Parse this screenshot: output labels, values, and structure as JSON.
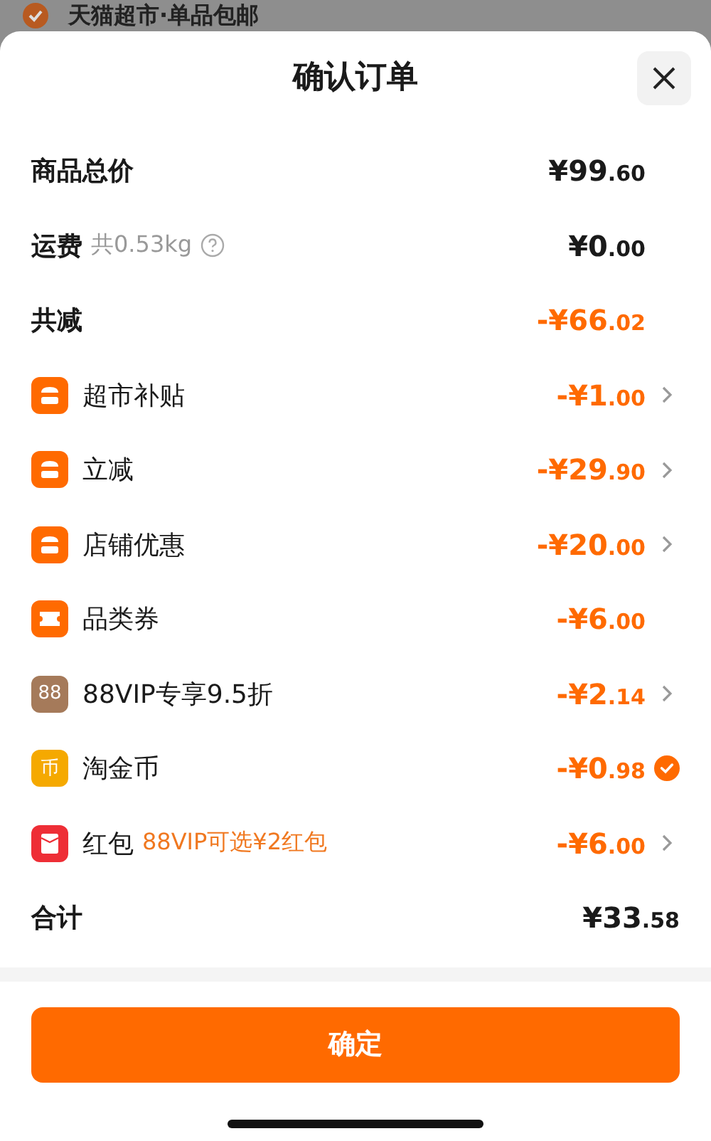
{
  "background": {
    "checked": true,
    "text": "天猫超市·单品包邮"
  },
  "sheet": {
    "title": "确认订单"
  },
  "summary": [
    {
      "label": "商品总价",
      "whole": "¥99",
      "cents": ".60",
      "highlight": false
    },
    {
      "label": "运费",
      "note": "共0.53kg",
      "help": true,
      "whole": "¥0",
      "cents": ".00",
      "highlight": false
    },
    {
      "label": "共减",
      "whole": "-¥66",
      "cents": ".02",
      "highlight": true
    }
  ],
  "discounts": [
    {
      "kind": "store",
      "label": "超市补贴",
      "whole": "-¥1",
      "cents": ".00",
      "expandable": true
    },
    {
      "kind": "store",
      "label": "立减",
      "whole": "-¥29",
      "cents": ".90",
      "expandable": true
    },
    {
      "kind": "store",
      "label": "店铺优惠",
      "whole": "-¥20",
      "cents": ".00",
      "expandable": true
    },
    {
      "kind": "ticket",
      "label": "品类券",
      "whole": "-¥6",
      "cents": ".00",
      "expandable": false
    },
    {
      "kind": "badge",
      "icon_text": "88",
      "label": "88VIP专享9.5折",
      "whole": "-¥2",
      "cents": ".14",
      "expandable": true
    },
    {
      "kind": "coin",
      "icon_text": "币",
      "label": "淘金币",
      "whole": "-¥0",
      "cents": ".98",
      "checked": true
    },
    {
      "kind": "packet",
      "label": "红包",
      "promo": "88VIP可选¥2红包",
      "whole": "-¥6",
      "cents": ".00",
      "expandable": true
    }
  ],
  "total": {
    "label": "合计",
    "whole": "¥33",
    "cents": ".58"
  },
  "confirm_button": "确定"
}
